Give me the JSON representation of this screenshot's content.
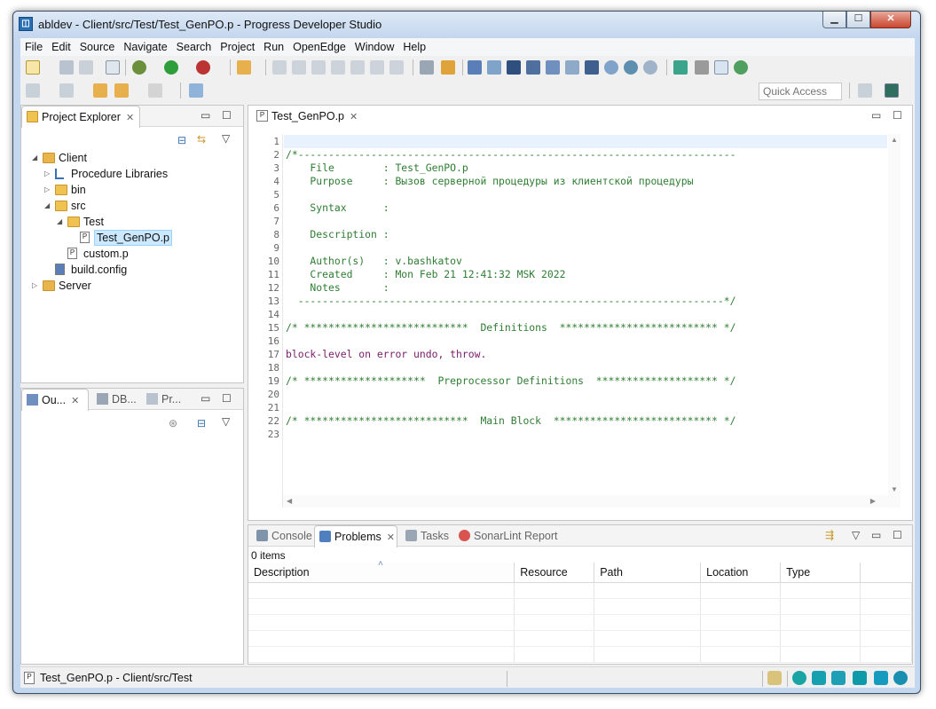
{
  "window": {
    "title": "abldev - Client/src/Test/Test_GenPO.p - Progress Developer Studio"
  },
  "menu": [
    "File",
    "Edit",
    "Source",
    "Navigate",
    "Search",
    "Project",
    "Run",
    "OpenEdge",
    "Window",
    "Help"
  ],
  "toolbar": {
    "quick_access_placeholder": "Quick Access"
  },
  "explorer": {
    "title": "Project Explorer",
    "items": [
      {
        "label": "Client",
        "level": 0,
        "expanded": true,
        "icon": "project-icon"
      },
      {
        "label": "Procedure Libraries",
        "level": 1,
        "expanded": false,
        "icon": "library-icon"
      },
      {
        "label": "bin",
        "level": 1,
        "expanded": false,
        "icon": "folder-icon"
      },
      {
        "label": "src",
        "level": 1,
        "expanded": true,
        "icon": "folder-icon"
      },
      {
        "label": "Test",
        "level": 2,
        "expanded": true,
        "icon": "folder-icon"
      },
      {
        "label": "Test_GenPO.p",
        "level": 3,
        "selected": true,
        "icon": "procedure-file-icon"
      },
      {
        "label": "custom.p",
        "level": 2,
        "icon": "procedure-file-icon"
      },
      {
        "label": "build.config",
        "level": 1,
        "icon": "config-file-icon"
      },
      {
        "label": "Server",
        "level": 0,
        "expanded": false,
        "icon": "project-icon"
      }
    ]
  },
  "outline": {
    "tabs": [
      "Ou...",
      "DB...",
      "Pr..."
    ]
  },
  "editor": {
    "tab_label": "Test_GenPO.p",
    "lines": [
      {
        "n": "1",
        "text": "",
        "kind": "normal"
      },
      {
        "n": "2",
        "text": "/*------------------------------------------------------------------------",
        "kind": "comment"
      },
      {
        "n": "3",
        "text": "    File        : Test_GenPO.p",
        "kind": "comment"
      },
      {
        "n": "4",
        "text": "    Purpose     : Вызов серверной процедуры из клиентской процедуры",
        "kind": "comment"
      },
      {
        "n": "5",
        "text": "",
        "kind": "comment"
      },
      {
        "n": "6",
        "text": "    Syntax      :",
        "kind": "comment"
      },
      {
        "n": "7",
        "text": "",
        "kind": "comment"
      },
      {
        "n": "8",
        "text": "    Description :",
        "kind": "comment"
      },
      {
        "n": "9",
        "text": "",
        "kind": "comment"
      },
      {
        "n": "10",
        "text": "    Author(s)   : v.bashkatov",
        "kind": "comment"
      },
      {
        "n": "11",
        "text": "    Created     : Mon Feb 21 12:41:32 MSK 2022",
        "kind": "comment"
      },
      {
        "n": "12",
        "text": "    Notes       :",
        "kind": "comment"
      },
      {
        "n": "13",
        "text": "  ----------------------------------------------------------------------*/",
        "kind": "comment"
      },
      {
        "n": "14",
        "text": "",
        "kind": "normal"
      },
      {
        "n": "15",
        "text": "/* ***************************  Definitions  ************************** */",
        "kind": "comment"
      },
      {
        "n": "16",
        "text": "",
        "kind": "normal"
      },
      {
        "n": "17",
        "text": "block-level on error undo, throw.",
        "kind": "keyword"
      },
      {
        "n": "18",
        "text": "",
        "kind": "normal"
      },
      {
        "n": "19",
        "text": "/* ********************  Preprocessor Definitions  ******************** */",
        "kind": "comment"
      },
      {
        "n": "20",
        "text": "",
        "kind": "normal"
      },
      {
        "n": "21",
        "text": "",
        "kind": "normal"
      },
      {
        "n": "22",
        "text": "/* ***************************  Main Block  *************************** */",
        "kind": "comment"
      },
      {
        "n": "23",
        "text": "",
        "kind": "normal"
      }
    ]
  },
  "bottom": {
    "tabs": [
      {
        "label": "Console",
        "active": false
      },
      {
        "label": "Problems",
        "active": true
      },
      {
        "label": "Tasks",
        "active": false
      },
      {
        "label": "SonarLint Report",
        "active": false
      }
    ],
    "items_count": "0 items",
    "columns": [
      "Description",
      "Resource",
      "Path",
      "Location",
      "Type"
    ]
  },
  "status": {
    "selection": "Test_GenPO.p - Client/src/Test"
  },
  "colors": {
    "comment": "#2e7d32",
    "keyword": "#7a1b6b",
    "selection": "#cce8ff"
  }
}
